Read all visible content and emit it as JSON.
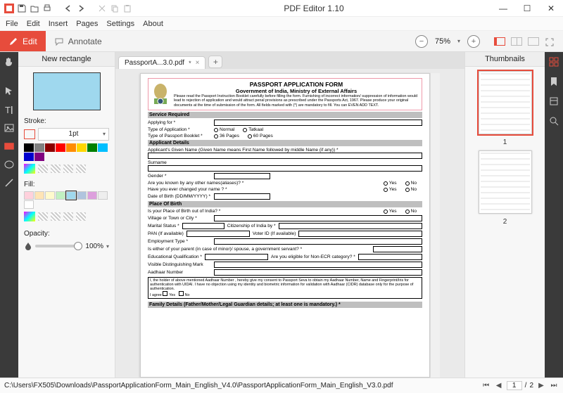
{
  "app": {
    "title": "PDF Editor 1.10"
  },
  "menu": [
    "File",
    "Edit",
    "Insert",
    "Pages",
    "Settings",
    "About"
  ],
  "modes": {
    "edit": "Edit",
    "annotate": "Annotate"
  },
  "zoom": {
    "value": "75%"
  },
  "left_panel": {
    "title": "New rectangle",
    "stroke_label": "Stroke:",
    "stroke_width": "1pt",
    "fill_label": "Fill:",
    "opacity_label": "Opacity:",
    "opacity_value": "100%",
    "stroke_colors": [
      "#000000",
      "#808080",
      "#8b0000",
      "#ff0000",
      "#ff8c00",
      "#ffd700",
      "#008000",
      "#00bfff",
      "#0000cd",
      "#800080"
    ],
    "fill_colors": [
      "#ffd1dc",
      "#ffe4b5",
      "#fffacd",
      "#c1f0c1",
      "#9fd8ee",
      "#b0c4de",
      "#dda0dd",
      "#eeeeee",
      "#ffffff"
    ]
  },
  "tab": {
    "label": "PassportA...3.0.pdf",
    "dirty": "*"
  },
  "right_panel": {
    "title": "Thumbnails",
    "pages": [
      "1",
      "2"
    ]
  },
  "status": {
    "path": "C:\\Users\\FX505\\Downloads\\PassportApplicationForm_Main_English_V4.0\\PassportApplicationForm_Main_English_V3.0.pdf",
    "page": "1",
    "total": "2",
    "sep": "/"
  },
  "doc": {
    "title": "PASSPORT APPLICATION FORM",
    "subtitle": "Government of India, Ministry of External Affairs",
    "instructions": "Please read the Passport Instruction Booklet carefully before filling the form. Furnishing of incorrect information/ suppression of information would lead to rejection of application and would attract penal provisions as prescribed under the Passports Act, 1967. Please produce your original documents at the time of submission of the form. All fields marked with (*) are mandatory to fill.  You can EVEN ADD TEXT.",
    "sections": {
      "service": "Service Required",
      "applicant": "Applicant Details",
      "pob": "Place Of Birth",
      "family": "Family Details (Father/Mother/Legal Guardian details; at least one is mandatory.) *"
    },
    "labels": {
      "applying_for": "Applying for *",
      "type_app": "Type of Application *",
      "type_booklet": "Type of Passport Booklet *",
      "given_name": "Applicant's Given Name (Given Name means First Name followed by middle Name (if any)) *",
      "surname": "Surname",
      "gender": "Gender *",
      "aliases": "Are you known by any other names(aliases)? *",
      "changed_name": "Have you ever changed your name ? *",
      "dob": "Date of Birth (DD/MM/YYYY) *",
      "pob_out": "Is your Place of Birth out of India? *",
      "village": "Village or Town or City *",
      "marital": "Marital Status *",
      "citizenship": "Citizenship of India by *",
      "pan": "PAN (If available)",
      "voter": "Voter ID (If available)",
      "employment": "Employment Type *",
      "parent_gov": "Is either of your parent (in case of minor)/ spouse, a government servant? *",
      "edu": "Educational Qualification *",
      "non_ecr": "Are you eligible for Non-ECR category? *",
      "dist_mark": "Visible Distinguishing Mark",
      "aadhaar": "Aadhaar Number",
      "aadhaar_consent": "I, the holder of above mentioned Aadhaar Number , hereby give my consent to Passport Seva to obtain my Aadhaar Number, Name and Fingerprint/Iris for authentication with UIDAI. I have no objection using my identity and biometric information for validation with Aadhaar (CIDR) database only for the purpose of authentication.",
      "agree": "I agree",
      "yes": "Yes",
      "no": "No",
      "normal": "Normal",
      "tatkaal": "Tatkaal",
      "p36": "36 Pages",
      "p60": "60 Pages"
    }
  }
}
